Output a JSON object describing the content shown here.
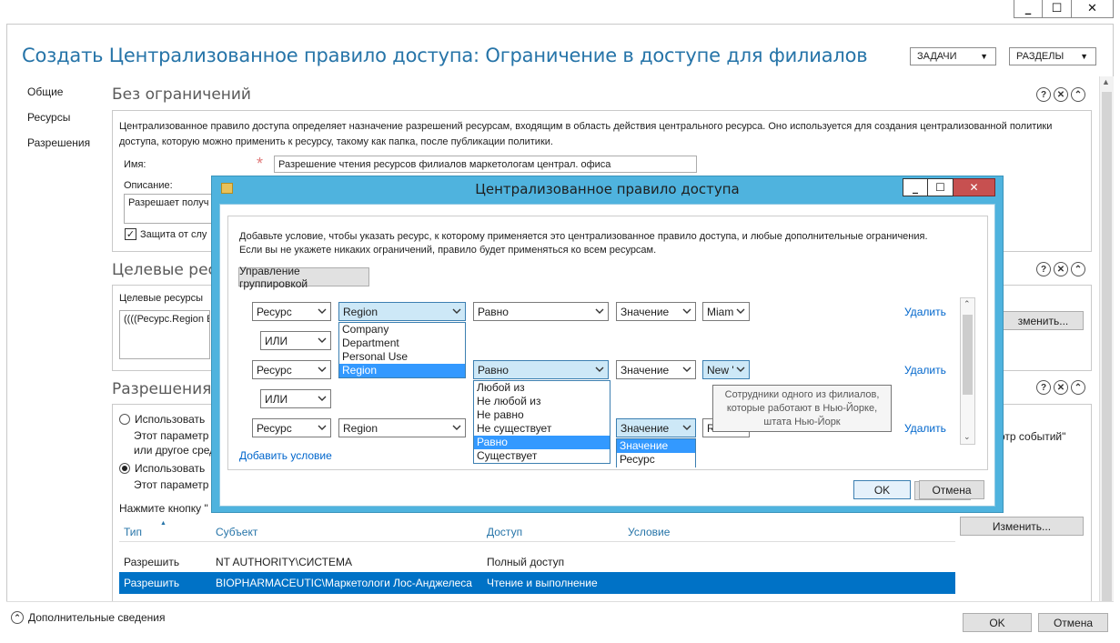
{
  "window": {
    "minimize": "_",
    "maximize": "☐",
    "close": "✕"
  },
  "header": {
    "title": "Создать Централизованное правило доступа: Ограничение в доступе для филиалов",
    "tasks_label": "ЗАДАЧИ",
    "sections_label": "РАЗДЕЛЫ"
  },
  "nav": {
    "items": [
      {
        "label": "Общие"
      },
      {
        "label": "Ресурсы"
      },
      {
        "label": "Разрешения"
      }
    ]
  },
  "general": {
    "title": "Без ограничений",
    "description": "Централизованное правило доступа определяет назначение разрешений ресурсам, входящим в область действия центрального ресурса. Оно используется для создания централизованной политики доступа, которую можно применить к ресурсу, такому как папка, после публикации политики.",
    "name_label": "Имя:",
    "required_mark": "*",
    "name_value": "Разрешение чтения ресурсов филиалов маркетологам централ. офиса",
    "desc_label": "Описание:",
    "desc_value": "Разрешает получ",
    "protect_label": "Защита от слу"
  },
  "resources": {
    "title": "Целевые ресу",
    "target_label": "Целевые ресурсы",
    "target_value": "((((Ресурс.Region E",
    "change_button": "зменить..."
  },
  "permissions": {
    "title": "Разрешения",
    "opt1": "Использовать",
    "opt1_desc1": "Этот параметр",
    "opt1_desc2": "или другое сред",
    "opt2": "Использовать",
    "opt2_desc": "Этот параметр",
    "hint": "Нажмите кнопку \"",
    "event_viewer": "отр событий\"",
    "change_button": "Изменить...",
    "columns": [
      "Тип",
      "Субъект",
      "Доступ",
      "Условие"
    ],
    "rows": [
      {
        "type": "Разрешить",
        "subject": "NT AUTHORITY\\СИСТЕМА",
        "access": "Полный доступ"
      },
      {
        "type": "Разрешить",
        "subject": "BIOPHARMACEUTIC\\Маркетологи Лос-Анджелеса",
        "access": "Чтение и выполнение"
      }
    ]
  },
  "footer": {
    "more_info": "Дополнительные сведения",
    "ok": "OK",
    "cancel": "Отмена"
  },
  "dialog": {
    "title": "Централизованное правило доступа",
    "instruction": "Добавьте условие, чтобы указать ресурс, к которому применяется это централизованное правило доступа, и любые дополнительные ограничения. Если вы не укажете никаких ограничений, правило будет применяться ко всем ресурсам.",
    "group_button": "Управление группировкой",
    "rows": [
      {
        "source": "Ресурс",
        "attribute": "Region",
        "operator": "Равно",
        "value_type": "Значение",
        "value": "Miam",
        "remove": "Удалить"
      },
      {
        "source": "Ресурс",
        "attribute": "",
        "operator": "Равно",
        "value_type": "Значение",
        "value": "New '",
        "remove": "Удалить"
      },
      {
        "source": "Ресурс",
        "attribute": "Region",
        "operator": "",
        "value_type": "Значение",
        "value": "Rhod",
        "remove": "Удалить"
      }
    ],
    "connectors": [
      "ИЛИ",
      "ИЛИ"
    ],
    "attribute_options": [
      "Company",
      "Department",
      "Personal Use",
      "Region"
    ],
    "operator_options": [
      "Любой из",
      "Не любой из",
      "Не равно",
      "Не существует",
      "Равно",
      "Существует"
    ],
    "value_type_options": [
      "Значение",
      "Ресурс"
    ],
    "add_condition": "Добавить условие",
    "tooltip": "Сотрудники одного из филиалов, которые работают в Нью-Йорке, штата Нью-Йорк",
    "ok": "OK",
    "cancel": "Отмена"
  }
}
